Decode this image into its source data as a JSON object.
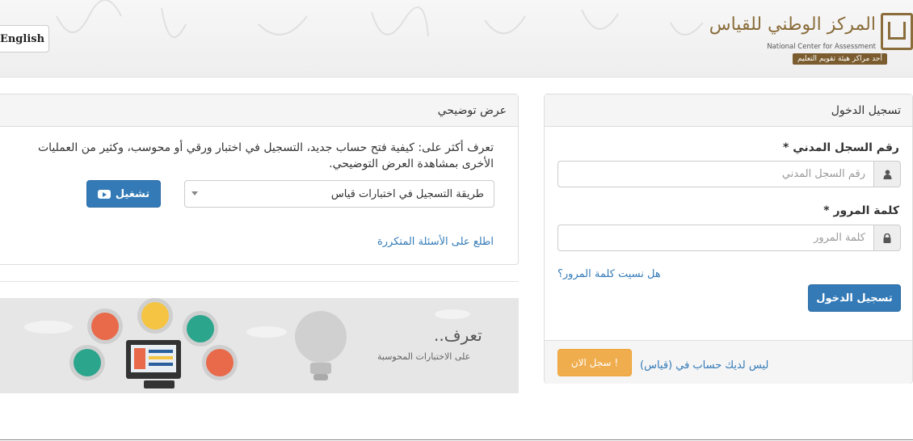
{
  "header": {
    "language_button": "English",
    "logo": {
      "arabic_name": "المركز الوطني للقياس",
      "english_name": "National Center for Assessment",
      "subtitle": "أحد مراكز هيئة تقويم التعليم"
    }
  },
  "login": {
    "title": "تسجيل الدخول",
    "id_label": "رقم السجل المدني *",
    "id_placeholder": "رقم السجل المدني",
    "password_label": "كلمة المرور *",
    "password_placeholder": "كلمة المرور",
    "forgot_password": "هل نسيت كلمة المرور؟",
    "submit": "تسجيل الدخول",
    "no_account": "ليس لديك حساب في (قياس)",
    "register": "سجل الان !"
  },
  "demo": {
    "title": "عرض توضيحي",
    "description": "تعرف أكثر على: كيفية فتح حساب جديد، التسجيل في اختبار ورقي أو محوسب، وكثير من العمليات الأخرى بمشاهدة العرض التوضيحي.",
    "selected_option": "طريقة التسجيل في اختبارات قياس",
    "play": "تشغيل",
    "faq_link": "اطلع على الأسئلة المتكررة"
  },
  "banner": {
    "title": "تعرف..",
    "subtitle": "على الاختبارات المحوسبة"
  },
  "colors": {
    "primary": "#337ab7",
    "warning": "#f0ad4e",
    "logo_gold": "#8a6d3b"
  },
  "icons": [
    "user-icon",
    "lock-icon",
    "play-icon",
    "caret-down-icon",
    "lightbulb-icon"
  ]
}
